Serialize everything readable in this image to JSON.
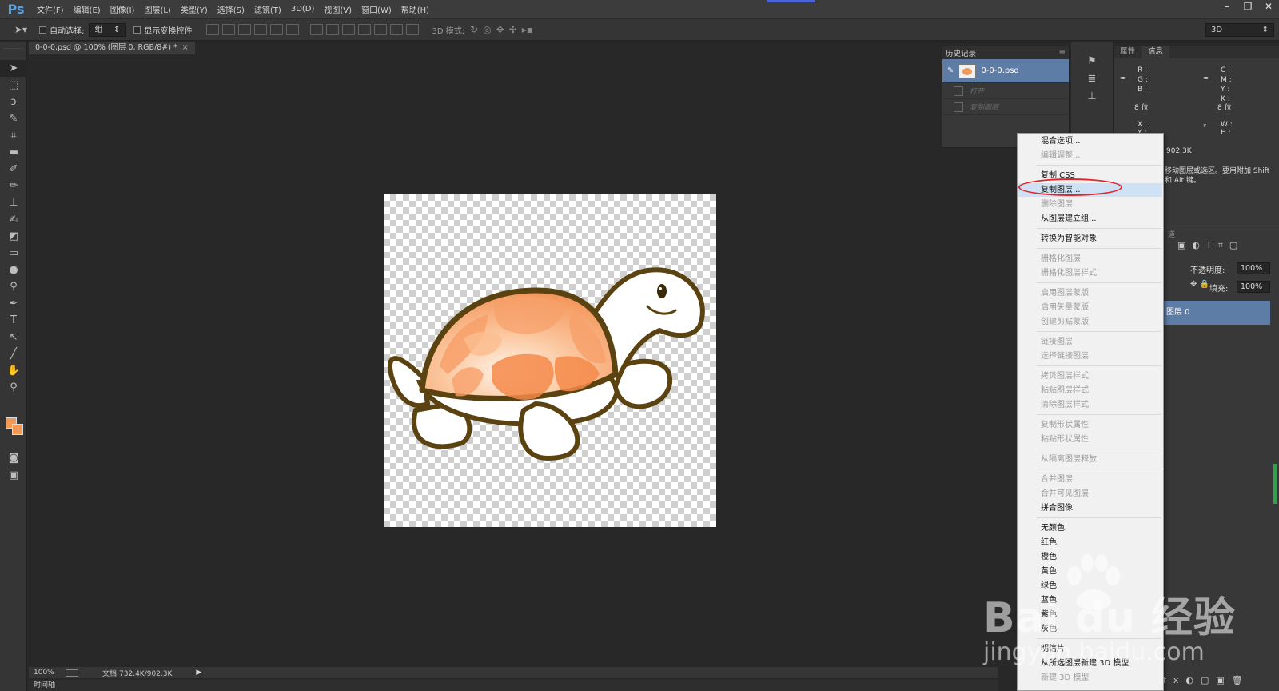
{
  "app": {
    "logo": "Ps"
  },
  "menubar": {
    "items": [
      "文件(F)",
      "编辑(E)",
      "图像(I)",
      "图层(L)",
      "类型(Y)",
      "选择(S)",
      "滤镜(T)",
      "3D(D)",
      "视图(V)",
      "窗口(W)",
      "帮助(H)"
    ]
  },
  "window": {
    "minimize": "–",
    "restore": "❐",
    "close": "✕"
  },
  "options": {
    "auto_select_label": "自动选择:",
    "auto_select_value": "组",
    "show_transform_label": "显示变换控件",
    "mode_3d_label": "3D 模式:",
    "workspace_value": "3D"
  },
  "document": {
    "tab_title": "0-0-0.psd @ 100% (图层 0, RGB/8#) *",
    "tab_close": "×"
  },
  "status": {
    "zoom": "100%",
    "doc_size": "文档:732.4K/902.3K",
    "arrow": "▶",
    "timeline": "时间轴"
  },
  "history": {
    "title": "历史记录",
    "snapshot": "0-0-0.psd",
    "steps": [
      "打开",
      "复制图层"
    ]
  },
  "info": {
    "tabs": [
      "属性",
      "信息"
    ],
    "rgb": [
      "R :",
      "G :",
      "B :"
    ],
    "cmyk": [
      "C :",
      "M :",
      "Y :",
      "K :"
    ],
    "bit_left": "8 位",
    "bit_right": "8 位",
    "x": "X :",
    "y": "Y :",
    "w": "W :",
    "h": "H :",
    "doc_size": "902.3K",
    "hint": "移动图层或选区。要用附加 Shift 和 Alt 键。"
  },
  "layers": {
    "opacity_label": "不透明度:",
    "opacity_value": "100%",
    "fill_label": "填充:",
    "fill_value": "100%",
    "layer_name": "图层 0",
    "tab_fragment": "道"
  },
  "context_menu": {
    "items": [
      {
        "label": "混合选项...",
        "enabled": true
      },
      {
        "label": "编辑调整...",
        "enabled": false
      },
      {
        "label": "复制 CSS",
        "enabled": true
      },
      {
        "label": "复制图层...",
        "enabled": true,
        "highlighted": true
      },
      {
        "label": "删除图层",
        "enabled": false
      },
      {
        "label": "从图层建立组...",
        "enabled": true
      },
      {
        "label": "转换为智能对象",
        "enabled": true
      },
      {
        "label": "栅格化图层",
        "enabled": false
      },
      {
        "label": "栅格化图层样式",
        "enabled": false
      },
      {
        "label": "启用图层蒙版",
        "enabled": false
      },
      {
        "label": "启用矢量蒙版",
        "enabled": false
      },
      {
        "label": "创建剪贴蒙版",
        "enabled": false
      },
      {
        "label": "链接图层",
        "enabled": false
      },
      {
        "label": "选择链接图层",
        "enabled": false
      },
      {
        "label": "拷贝图层样式",
        "enabled": false
      },
      {
        "label": "粘贴图层样式",
        "enabled": false
      },
      {
        "label": "清除图层样式",
        "enabled": false
      },
      {
        "label": "复制形状属性",
        "enabled": false
      },
      {
        "label": "粘贴形状属性",
        "enabled": false
      },
      {
        "label": "从隔离图层释放",
        "enabled": false
      },
      {
        "label": "合并图层",
        "enabled": false
      },
      {
        "label": "合并可见图层",
        "enabled": false
      },
      {
        "label": "拼合图像",
        "enabled": true
      },
      {
        "label": "无颜色",
        "enabled": true
      },
      {
        "label": "红色",
        "enabled": true
      },
      {
        "label": "橙色",
        "enabled": true
      },
      {
        "label": "黄色",
        "enabled": true
      },
      {
        "label": "绿色",
        "enabled": true
      },
      {
        "label": "蓝色",
        "enabled": true
      },
      {
        "label": "紫色",
        "enabled": true
      },
      {
        "label": "灰色",
        "enabled": true
      },
      {
        "label": "明信片",
        "enabled": true
      },
      {
        "label": "从所选图层新建 3D 模型",
        "enabled": true
      },
      {
        "label": "新建 3D 模型",
        "enabled": false
      }
    ]
  },
  "watermark": {
    "main": "Bai du 经验",
    "sub": "jingyan.baidu.com"
  },
  "colors": {
    "accent": "#5aa4e4",
    "selection": "#5d7ca6",
    "annotation": "#e0242a",
    "foreground": "#f29a55"
  }
}
